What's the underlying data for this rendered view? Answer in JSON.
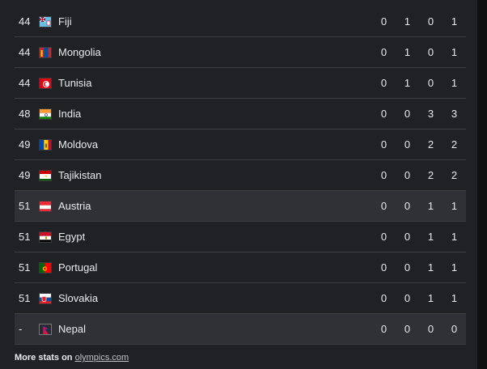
{
  "rows": [
    {
      "rank": "44",
      "country": "Fiji",
      "gold": "0",
      "silver": "1",
      "bronze": "0",
      "total": "1",
      "flag": "fiji-flag-icon",
      "highlight": false
    },
    {
      "rank": "44",
      "country": "Mongolia",
      "gold": "0",
      "silver": "1",
      "bronze": "0",
      "total": "1",
      "flag": "mongolia-flag-icon",
      "highlight": false
    },
    {
      "rank": "44",
      "country": "Tunisia",
      "gold": "0",
      "silver": "1",
      "bronze": "0",
      "total": "1",
      "flag": "tunisia-flag-icon",
      "highlight": false
    },
    {
      "rank": "48",
      "country": "India",
      "gold": "0",
      "silver": "0",
      "bronze": "3",
      "total": "3",
      "flag": "india-flag-icon",
      "highlight": false
    },
    {
      "rank": "49",
      "country": "Moldova",
      "gold": "0",
      "silver": "0",
      "bronze": "2",
      "total": "2",
      "flag": "moldova-flag-icon",
      "highlight": false
    },
    {
      "rank": "49",
      "country": "Tajikistan",
      "gold": "0",
      "silver": "0",
      "bronze": "2",
      "total": "2",
      "flag": "tajikistan-flag-icon",
      "highlight": false
    },
    {
      "rank": "51",
      "country": "Austria",
      "gold": "0",
      "silver": "0",
      "bronze": "1",
      "total": "1",
      "flag": "austria-flag-icon",
      "highlight": true
    },
    {
      "rank": "51",
      "country": "Egypt",
      "gold": "0",
      "silver": "0",
      "bronze": "1",
      "total": "1",
      "flag": "egypt-flag-icon",
      "highlight": false
    },
    {
      "rank": "51",
      "country": "Portugal",
      "gold": "0",
      "silver": "0",
      "bronze": "1",
      "total": "1",
      "flag": "portugal-flag-icon",
      "highlight": false
    },
    {
      "rank": "51",
      "country": "Slovakia",
      "gold": "0",
      "silver": "0",
      "bronze": "1",
      "total": "1",
      "flag": "slovakia-flag-icon",
      "highlight": false
    },
    {
      "rank": "-",
      "country": "Nepal",
      "gold": "0",
      "silver": "0",
      "bronze": "0",
      "total": "0",
      "flag": "nepal-flag-icon",
      "highlight": true
    }
  ],
  "footer": {
    "prefix": "More stats on",
    "link_text": "olympics.com"
  }
}
